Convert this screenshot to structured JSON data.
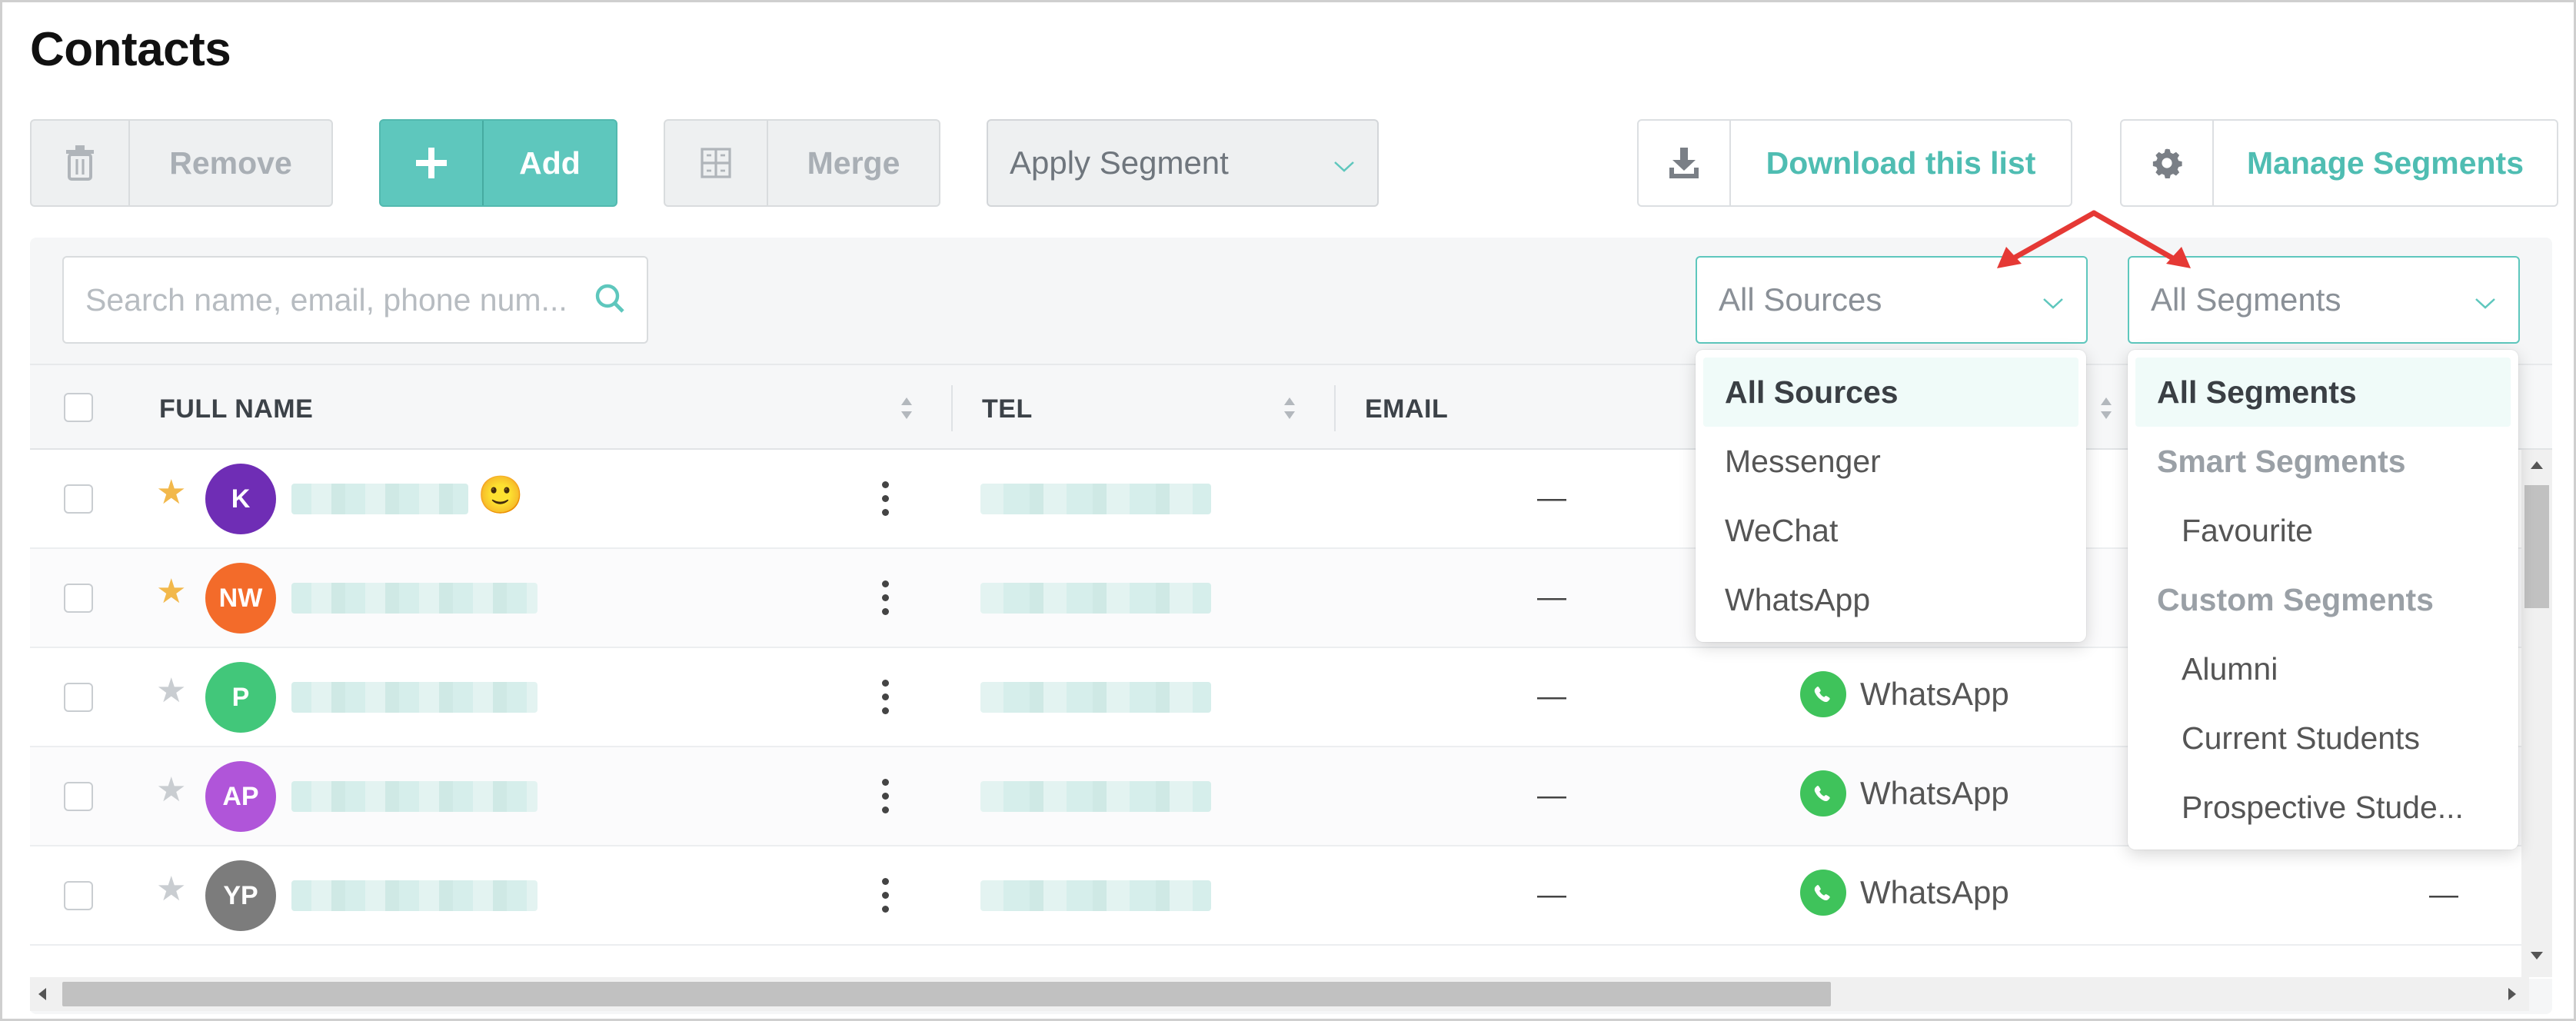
{
  "page": {
    "title": "Contacts"
  },
  "toolbar": {
    "remove_label": "Remove",
    "add_label": "Add",
    "merge_label": "Merge",
    "apply_segment_label": "Apply Segment",
    "download_label": "Download this list",
    "manage_segments_label": "Manage Segments"
  },
  "filters": {
    "search_placeholder": "Search name, email, phone num...",
    "sources_selected": "All Sources",
    "segments_selected": "All Segments"
  },
  "table": {
    "columns": {
      "full_name": "FULL NAME",
      "tel": "TEL",
      "email": "EMAIL"
    },
    "rows": [
      {
        "initials": "K",
        "avatar_color": "#6f2db5",
        "starred": true,
        "email": "—",
        "source": ""
      },
      {
        "initials": "NW",
        "avatar_color": "#f36b2a",
        "starred": true,
        "email": "—",
        "source": ""
      },
      {
        "initials": "P",
        "avatar_color": "#42c77a",
        "starred": false,
        "email": "—",
        "source": "WhatsApp"
      },
      {
        "initials": "AP",
        "avatar_color": "#b055d9",
        "starred": false,
        "email": "—",
        "source": "WhatsApp"
      },
      {
        "initials": "YP",
        "avatar_color": "#7c7c7c",
        "starred": false,
        "email": "—",
        "source": "WhatsApp",
        "extra": "—"
      }
    ]
  },
  "sources_menu": {
    "items": [
      "All Sources",
      "Messenger",
      "WeChat",
      "WhatsApp"
    ]
  },
  "segments_menu": {
    "all": "All Segments",
    "smart_group": "Smart Segments",
    "smart_items": [
      "Favourite"
    ],
    "custom_group": "Custom Segments",
    "custom_items": [
      "Alumni",
      "Current Students",
      "Prospective Stude..."
    ]
  },
  "colors": {
    "accent": "#5ec7bd",
    "whatsapp": "#3fc35b",
    "star_on": "#f2b84b",
    "star_off": "#c9cdd1",
    "arrow": "#e53935"
  }
}
